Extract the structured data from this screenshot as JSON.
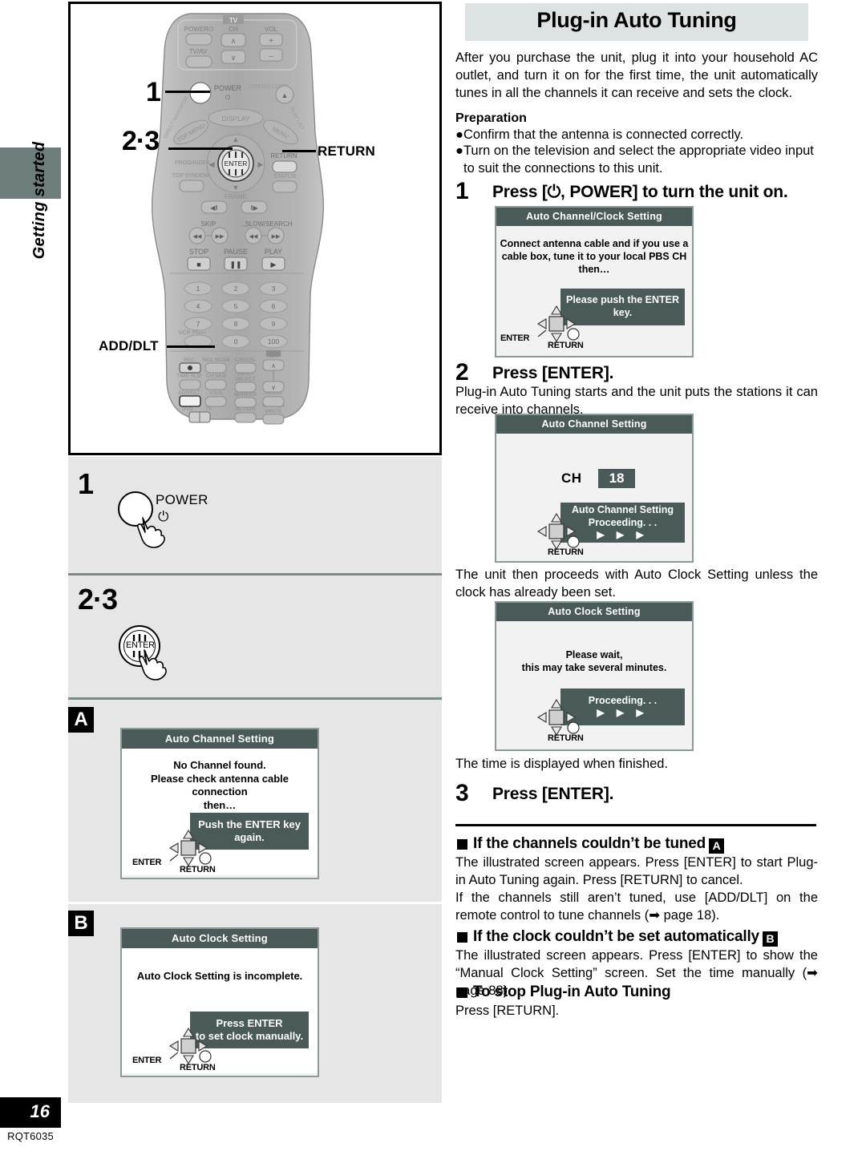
{
  "sidebar": {
    "section_label": "Getting started",
    "page_number": "16",
    "doc_code": "RQT6035"
  },
  "remote_callouts": {
    "step1": "1",
    "step23": "2·3",
    "return_label": "RETURN",
    "add_dlt_label": "ADD/DLT",
    "remote_keys": {
      "tv": "TV",
      "tv_power": "POWER",
      "tv_av": "TV/AV",
      "ch": "CH",
      "vol": "VOL",
      "power": "POWER",
      "open_close": "OPEN/CLOSE",
      "display": "DISPLAY",
      "top_menu": "TOP MENU",
      "direct_navigator": "DIRECT NAVIGATOR",
      "menu": "MENU",
      "playlist": "PLAY LIST",
      "prog_index": "PROG/INDEX",
      "enter": "ENTER",
      "return": "RETURN",
      "top_window": "TOP WINDOW",
      "status": "STATUS",
      "frame": "FRAME",
      "skip": "SKIP",
      "slow_search": "SLOW/SEARCH",
      "stop": "STOP",
      "pause": "PAUSE",
      "play": "PLAY",
      "vcr_plus": "VCR Plus+",
      "rec": "REC",
      "rec_mode": "REC MODE",
      "cancel": "CANCEL",
      "time_slip": "TIME SLIP",
      "ch_skip": "CH SKIP",
      "input_select": "INPUT SELECT",
      "add_dlt": "ADD/DLT",
      "vss": "V.S.S.",
      "last_marker": "LAST MARKER",
      "audio": "AUDIO",
      "dvd_tv": "DVD              TV",
      "action": "ACTION",
      "marker_write": "MARKER WRITE",
      "numbers": [
        "1",
        "2",
        "3",
        "4",
        "5",
        "6",
        "7",
        "8",
        "9",
        "0",
        "100"
      ]
    }
  },
  "left_panels": {
    "panel1": {
      "step": "1",
      "button_label": "POWER",
      "power_glyph": "⏻"
    },
    "panel23": {
      "step": "2·3",
      "button_label": "ENTER"
    }
  },
  "screen_a": {
    "marker": "A",
    "title": "Auto Channel Setting",
    "message_lines": [
      "No Channel found.",
      "Please check antenna cable connection",
      "then…"
    ],
    "box_lines": [
      "Push the ENTER key again."
    ],
    "nav_enter": "ENTER",
    "nav_return": "RETURN"
  },
  "screen_b": {
    "marker": "B",
    "title": "Auto Clock Setting",
    "message_lines": [
      "Auto Clock Setting is incomplete."
    ],
    "box_lines": [
      "Press ENTER",
      "to set clock manually."
    ],
    "nav_enter": "ENTER",
    "nav_return": "RETURN"
  },
  "header": {
    "title": "Plug-in Auto Tuning"
  },
  "intro": {
    "paragraph": "After you purchase the unit, plug it into your household AC outlet, and turn it on for the first time, the unit automatically tunes in all the channels it can receive and sets the clock.",
    "preparation_heading": "Preparation",
    "preparation_items": [
      "Confirm that the antenna is connected correctly.",
      "Turn on the television and select the appropriate video input to suit the connections to this unit."
    ]
  },
  "steps": [
    {
      "number": "1",
      "heading": "Press [⏻, POWER] to turn the unit on.",
      "screen": {
        "title": "Auto Channel/Clock Setting",
        "message_lines": [
          "Connect antenna cable and if you use a",
          "cable box, tune it to your local PBS CH",
          "then…"
        ],
        "box_lines": [
          "Please push the ENTER key."
        ],
        "nav_enter": "ENTER",
        "nav_return": "RETURN"
      }
    },
    {
      "number": "2",
      "heading": "Press [ENTER].",
      "body": "Plug-in Auto Tuning starts and the unit puts the stations it can receive into channels.",
      "screen": {
        "title": "Auto Channel Setting",
        "ch_label": "CH",
        "ch_value": "18",
        "box_lines": [
          "Auto Channel Setting",
          "Proceeding. . ."
        ],
        "arrows": "▶ ▶ ▶",
        "nav_return": "RETURN"
      },
      "after_text": "The unit then proceeds with Auto Clock Setting unless the clock has already been set.",
      "screen2": {
        "title": "Auto Clock Setting",
        "message_lines": [
          "Please wait,",
          "this may take several minutes."
        ],
        "box_lines": [
          "Proceeding. . ."
        ],
        "arrows": "▶ ▶ ▶",
        "nav_return": "RETURN"
      },
      "after_text2": "The time is displayed when finished."
    },
    {
      "number": "3",
      "heading": "Press [ENTER]."
    }
  ],
  "notes": [
    {
      "heading": "If the channels couldn’t be tuned",
      "marker": "A",
      "body": "The illustrated screen appears. Press [ENTER] to start Plug-in Auto Tuning again. Press [RETURN] to cancel.\nIf the channels still aren’t tuned, use [ADD/DLT] on the remote control to tune channels (➡ page 18)."
    },
    {
      "heading": "If the clock couldn’t be set automatically",
      "marker": "B",
      "body": "The illustrated screen appears. Press [ENTER] to show the “Manual Clock Setting” screen. Set the time manually (➡ page 88)."
    },
    {
      "heading": "To stop Plug-in Auto Tuning",
      "marker": "",
      "body": "Press [RETURN]."
    }
  ],
  "colors": {
    "screen_title_bar": "#4a5a58",
    "banner_bg": "#dde3e2",
    "panel_bg": "#e6e6e6",
    "tab_bg": "#6d7d7b"
  }
}
